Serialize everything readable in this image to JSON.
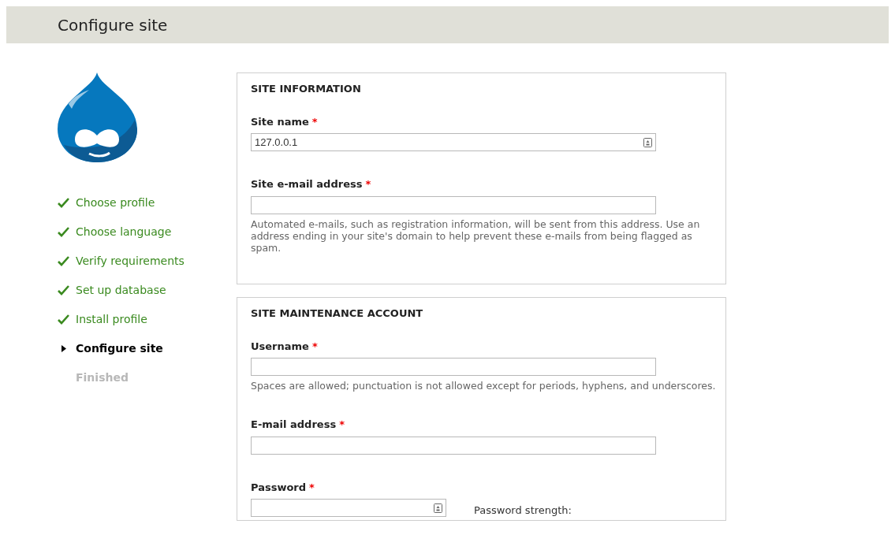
{
  "header": {
    "title": "Configure site"
  },
  "steps": [
    {
      "label": "Choose profile",
      "done": true,
      "current": false
    },
    {
      "label": "Choose language",
      "done": true,
      "current": false
    },
    {
      "label": "Verify requirements",
      "done": true,
      "current": false
    },
    {
      "label": "Set up database",
      "done": true,
      "current": false
    },
    {
      "label": "Install profile",
      "done": true,
      "current": false
    },
    {
      "label": "Configure site",
      "done": false,
      "current": true
    },
    {
      "label": "Finished",
      "done": false,
      "current": false
    }
  ],
  "fieldsets": [
    {
      "legend": "SITE INFORMATION",
      "fields": [
        {
          "kind": "text",
          "label": "Site name",
          "required_mark": "*",
          "value": "127.0.0.1",
          "autofill_icon": true
        },
        {
          "kind": "text",
          "label": "Site e-mail address",
          "required_mark": "*",
          "description": "Automated e-mails, such as registration information, will be sent from this address. Use an address ending in your site's domain to help prevent these e-mails from being flagged as spam."
        }
      ]
    },
    {
      "legend": "SITE MAINTENANCE ACCOUNT",
      "fields": [
        {
          "kind": "text",
          "label": "Username",
          "required_mark": "*",
          "description": "Spaces are allowed; punctuation is not allowed except for periods, hyphens, and underscores."
        },
        {
          "kind": "text",
          "label": "E-mail address",
          "required_mark": "*"
        },
        {
          "kind": "password",
          "label": "Password",
          "required_mark": "*",
          "autofill_icon": true,
          "strength_label": "Password strength:"
        }
      ]
    }
  ]
}
